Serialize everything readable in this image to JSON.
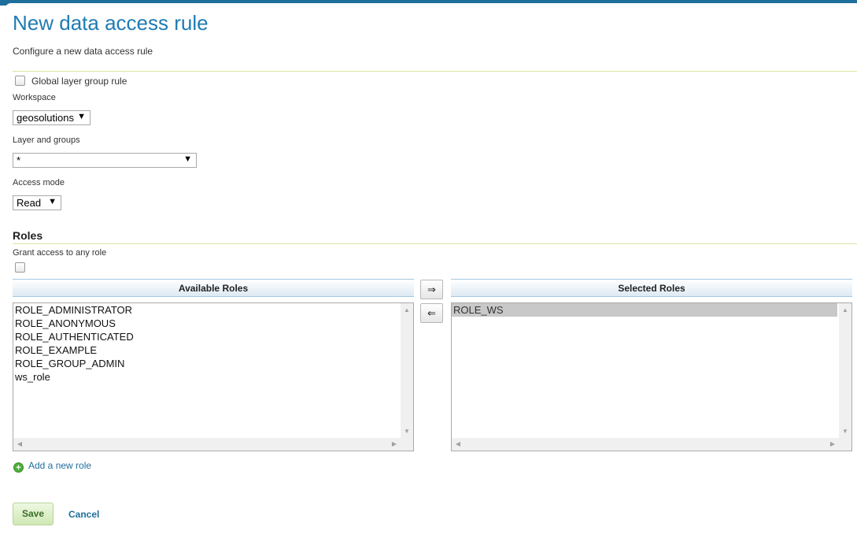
{
  "header": {
    "title": "New data access rule",
    "description": "Configure a new data access rule"
  },
  "form": {
    "global_layer_group_label": "Global layer group rule",
    "workspace_label": "Workspace",
    "workspace_value": "geosolutions",
    "layer_label": "Layer and groups",
    "layer_value": "*",
    "access_mode_label": "Access mode",
    "access_mode_value": "Read"
  },
  "roles": {
    "section_title": "Roles",
    "grant_any_label": "Grant access to any role",
    "available_header": "Available Roles",
    "selected_header": "Selected Roles",
    "available": [
      "ROLE_ADMINISTRATOR",
      "ROLE_ANONYMOUS",
      "ROLE_AUTHENTICATED",
      "ROLE_EXAMPLE",
      "ROLE_GROUP_ADMIN",
      "ws_role"
    ],
    "selected": [
      "ROLE_WS"
    ],
    "move_right_symbol": "⇒",
    "move_left_symbol": "⇐",
    "add_role_label": "Add a new role"
  },
  "actions": {
    "save_label": "Save",
    "cancel_label": "Cancel"
  },
  "colors": {
    "title": "#1f7bb3",
    "link": "#1f6f9c",
    "divider": "#dfe3a0",
    "header_bar": "#1f6f9c"
  }
}
